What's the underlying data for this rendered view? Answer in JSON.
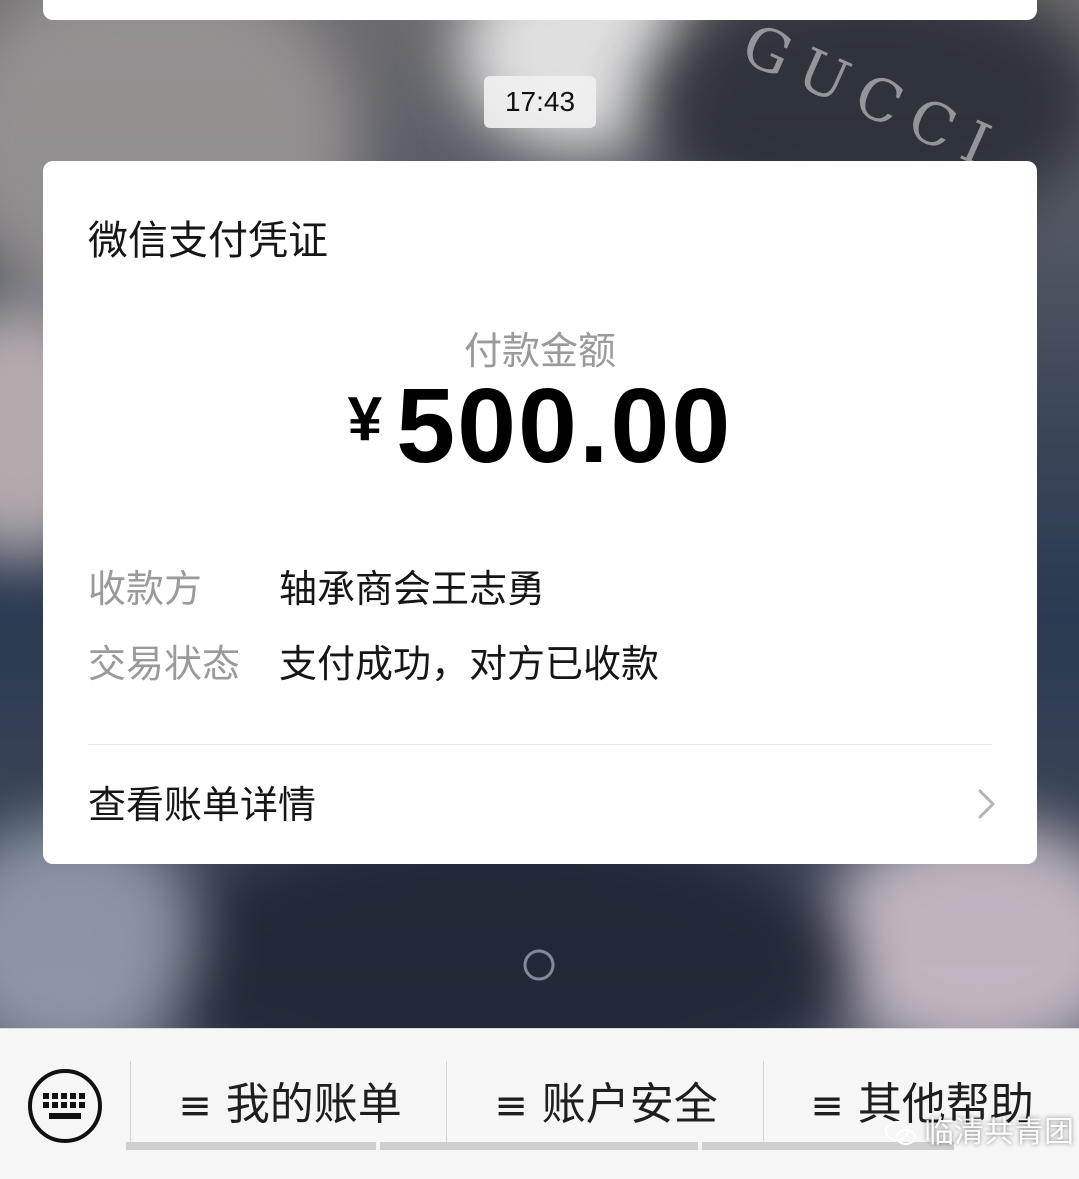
{
  "chat": {
    "timestamp": "17:43",
    "background_text": "GUCCI"
  },
  "receipt": {
    "title": "微信支付凭证",
    "amount_label": "付款金额",
    "currency_symbol": "¥",
    "amount": "500.00",
    "rows": [
      {
        "key": "收款方",
        "value": "轴承商会王志勇"
      },
      {
        "key": "交易状态",
        "value": "支付成功，对方已收款"
      }
    ],
    "bill_link": "查看账单详情"
  },
  "bottom_menu": {
    "items": [
      {
        "icon": "≡",
        "label": "我的账单"
      },
      {
        "icon": "≡",
        "label": "账户安全"
      },
      {
        "icon": "≡",
        "label": "其他帮助"
      }
    ]
  },
  "watermark": {
    "text": "临清共青团"
  },
  "colors": {
    "card_bg": "#ffffff",
    "muted_text": "#9a9a9a",
    "primary_text": "#161616",
    "bottom_bar_bg": "#f6f6f6"
  }
}
